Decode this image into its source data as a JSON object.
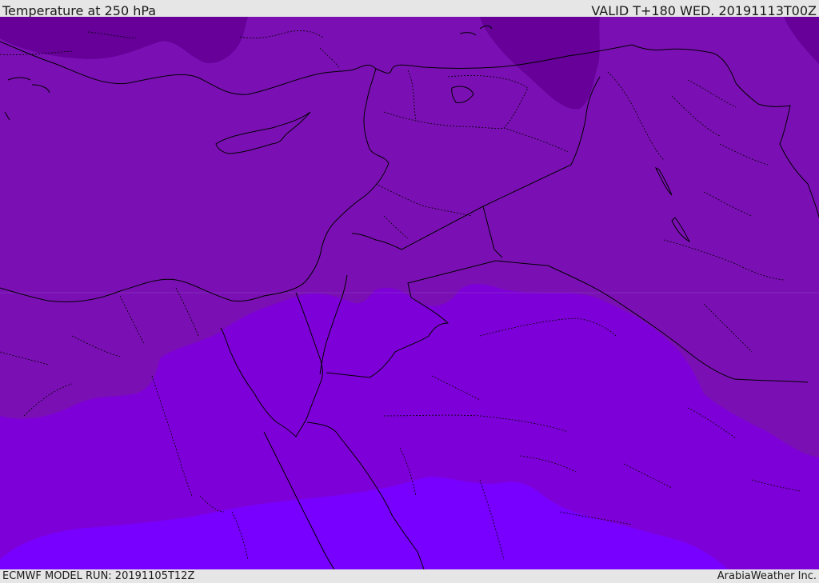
{
  "header": {
    "title": "Temperature at 250 hPa",
    "valid": "VALID T+180 WED. 20191113T00Z"
  },
  "footer": {
    "model_run": "ECMWF MODEL RUN: 20191105T12Z",
    "credit": "ArabiaWeather Inc."
  },
  "colors": {
    "band_darkest": "#660099",
    "band_dark": "#7a10b3",
    "band_mid": "#7e00d8",
    "band_light": "#7700ff",
    "boundary_line": "#000000",
    "frame": "#e6e6e6"
  }
}
